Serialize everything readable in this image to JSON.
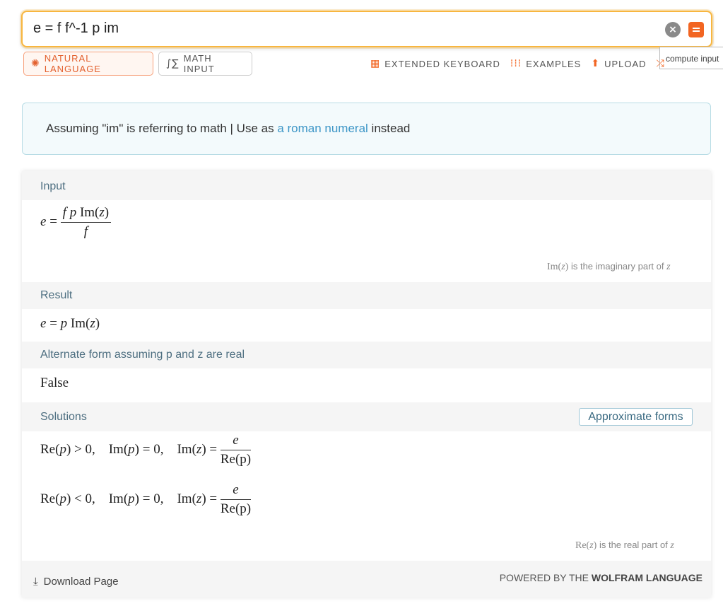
{
  "search": {
    "query": "e = f f^-1 p im",
    "clear_icon": "×"
  },
  "tooltip": "compute input",
  "modes": {
    "natural_language": "NATURAL LANGUAGE",
    "math_input": "MATH INPUT"
  },
  "toolbar": {
    "keyboard": "EXTENDED KEYBOARD",
    "examples": "EXAMPLES",
    "upload": "UPLOAD"
  },
  "assumption": {
    "prefix": "Assuming \"im\" is referring to math | Use as ",
    "link": "a roman numeral",
    "suffix": " instead"
  },
  "pods": {
    "input": {
      "title": "Input",
      "lhs": "e",
      "num_f": "f",
      "num_p": "p",
      "num_im": "Im(",
      "num_z": "z",
      "num_close": ")",
      "den": "f",
      "note_fn": "Im(",
      "note_var": "z",
      "note_close": ")",
      "note_text": " is the imaginary part of ",
      "note_end": "z"
    },
    "result": {
      "title": "Result",
      "lhs": "e",
      "rhs_p": "p",
      "rhs_im": "Im(",
      "rhs_z": "z",
      "rhs_close": ")"
    },
    "alternate": {
      "title": "Alternate form assuming p and z are real",
      "value": "False"
    },
    "solutions": {
      "title": "Solutions",
      "button": "Approximate forms",
      "rows": [
        {
          "re_cond": "> 0"
        },
        {
          "re_cond": "< 0"
        }
      ],
      "num": "e",
      "den": "Re(p)",
      "note_fn": "Re(",
      "note_var": "z",
      "note_close": ")",
      "note_text": " is the real part of ",
      "note_end": "z"
    }
  },
  "footer": {
    "download": "Download Page",
    "powered_prefix": "POWERED BY THE ",
    "powered_brand": "WOLFRAM LANGUAGE"
  },
  "colors": {
    "accent": "#f26522",
    "search_border": "#f8b63f",
    "link": "#3d96c7",
    "pod_header": "#4e6f81"
  }
}
